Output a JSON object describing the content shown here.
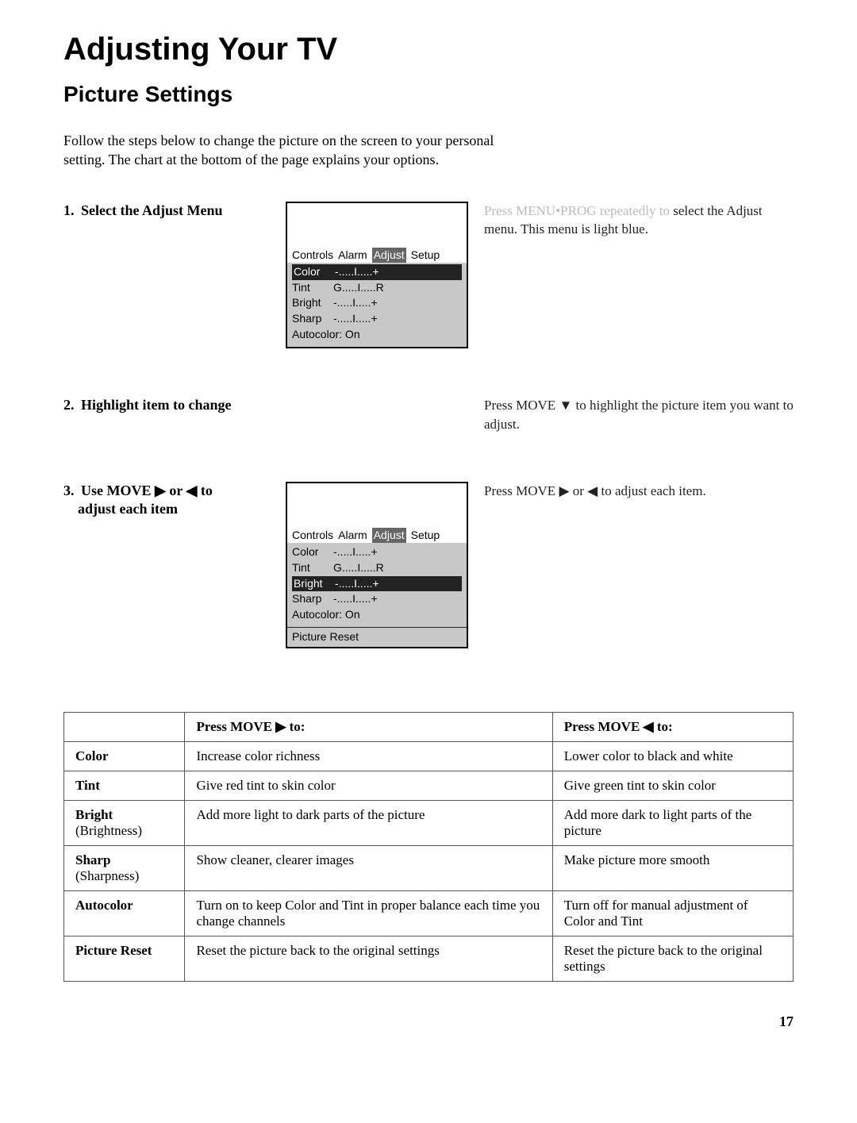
{
  "title": "Adjusting Your TV",
  "subtitle": "Picture Settings",
  "intro_a": "Follow the steps below to change the picture on the screen to your personal",
  "intro_b": "setting. The chart at the bottom of the page explains your options.",
  "steps": [
    {
      "num": "1.",
      "label": "Select the Adjust Menu",
      "desc_a": "Press MENU•PROG repeatedly to",
      "desc_b": "select the Adjust menu. This menu is light blue."
    },
    {
      "num": "2.",
      "label": "Highlight item to change",
      "desc_a": "Press MOVE ▼ to highlight the",
      "desc_b": "picture item you want to adjust."
    },
    {
      "num": "3.",
      "label_a": "Use MOVE ▶ or ◀ to",
      "label_b": "adjust each item",
      "desc_a": "Press MOVE ▶ or ◀ to adjust each",
      "desc_b": "item."
    }
  ],
  "osd": {
    "tabs": [
      "Controls",
      "Alarm",
      "Adjust",
      "Setup"
    ],
    "lines": {
      "color": "Color",
      "tint": "Tint",
      "bright": "Bright",
      "sharp": "Sharp",
      "autocolor": "Autocolor: On",
      "picture_reset": "Picture Reset"
    },
    "bars": {
      "plusminus": "-.....I.....+",
      "gr": "G.....I.....R"
    }
  },
  "table": {
    "head_right": "Press  MOVE ▶ to:",
    "head_left": "Press  MOVE ◀ to:",
    "rows": [
      {
        "name": "Color",
        "sub": "",
        "right": "Increase color richness",
        "left": "Lower color to black and white"
      },
      {
        "name": "Tint",
        "sub": "",
        "right": "Give red tint to skin color",
        "left": "Give green tint to skin color"
      },
      {
        "name": "Bright",
        "sub": " (Brightness)",
        "right": "Add more light to dark parts of the picture",
        "left": "Add more dark to light parts of the picture"
      },
      {
        "name": "Sharp",
        "sub": " (Sharpness)",
        "right": "Show cleaner, clearer images",
        "left": "Make picture more smooth"
      },
      {
        "name": "Autocolor",
        "sub": "",
        "right": "Turn on to keep Color and Tint in proper balance each time you change channels",
        "left": "Turn off for manual adjustment of Color and Tint"
      },
      {
        "name": "Picture Reset",
        "sub": "",
        "right": "Reset the picture back to the original settings",
        "left": "Reset the picture back to the original settings"
      }
    ]
  },
  "page_number": "17"
}
